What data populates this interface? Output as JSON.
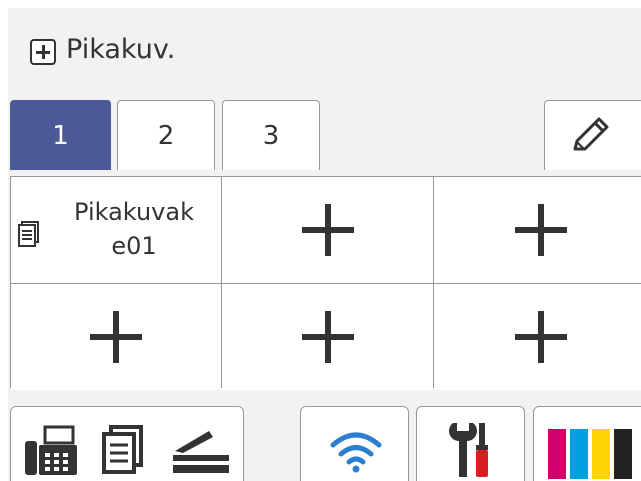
{
  "header": {
    "title": "Pikakuv.",
    "icon": "plus-box-icon"
  },
  "tabs": [
    {
      "label": "1",
      "active": true
    },
    {
      "label": "2",
      "active": false
    },
    {
      "label": "3",
      "active": false
    }
  ],
  "edit_button": {
    "icon": "pencil-icon"
  },
  "shortcuts": [
    {
      "label": "Pikakuvak e01",
      "icon": "document-icon"
    },
    {
      "label": "",
      "icon": "plus-icon"
    },
    {
      "label": "",
      "icon": "plus-icon"
    },
    {
      "label": "",
      "icon": "plus-icon"
    },
    {
      "label": "",
      "icon": "plus-icon"
    },
    {
      "label": "",
      "icon": "plus-icon"
    }
  ],
  "bottom_bar": {
    "modes_button_icons": [
      "fax-icon",
      "copy-icon",
      "scan-icon"
    ],
    "wifi_icon": "wifi-icon",
    "tools_icon": "tools-icon",
    "ink_icon": "ink-cartridges-icon"
  },
  "colors": {
    "active_tab": "#4b5a96",
    "ink_magenta": "#d0006f",
    "ink_cyan": "#00a0e0",
    "ink_yellow": "#ffd400",
    "ink_black": "#222222",
    "wifi": "#2a7fd0",
    "tool_red": "#d81e1e"
  }
}
